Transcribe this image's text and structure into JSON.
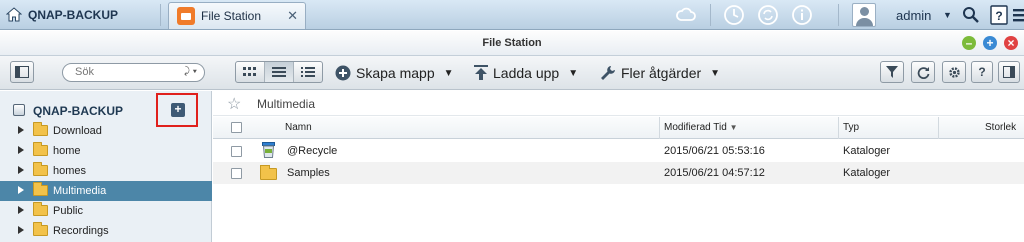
{
  "taskbar": {
    "home_label": "QNAP-BACKUP",
    "app_tab_title": "File Station",
    "app_tab_close": "✕",
    "user_name": "admin"
  },
  "window": {
    "title": "File Station"
  },
  "toolbar": {
    "search_placeholder": "Sök",
    "create_folder_label": "Skapa mapp",
    "upload_label": "Ladda upp",
    "more_actions_label": "Fler åtgärder"
  },
  "tree": {
    "root_label": "QNAP-BACKUP",
    "items": [
      {
        "label": "Download",
        "selected": false
      },
      {
        "label": "home",
        "selected": false
      },
      {
        "label": "homes",
        "selected": false
      },
      {
        "label": "Multimedia",
        "selected": true
      },
      {
        "label": "Public",
        "selected": false
      },
      {
        "label": "Recordings",
        "selected": false
      }
    ]
  },
  "breadcrumb": {
    "path": "Multimedia"
  },
  "list": {
    "columns": {
      "name": "Namn",
      "modified": "Modifierad Tid",
      "type": "Typ",
      "size": "Storlek"
    },
    "rows": [
      {
        "name": "@Recycle",
        "modified": "2015/06/21 05:53:16",
        "type": "Kataloger",
        "icon": "recycle-bin-icon"
      },
      {
        "name": "Samples",
        "modified": "2015/06/21 04:57:12",
        "type": "Kataloger",
        "icon": "folder-icon"
      }
    ]
  },
  "colors": {
    "accent_selected": "#4c86a8",
    "highlight_box": "#e0201c",
    "app_icon": "#f07b2a"
  }
}
